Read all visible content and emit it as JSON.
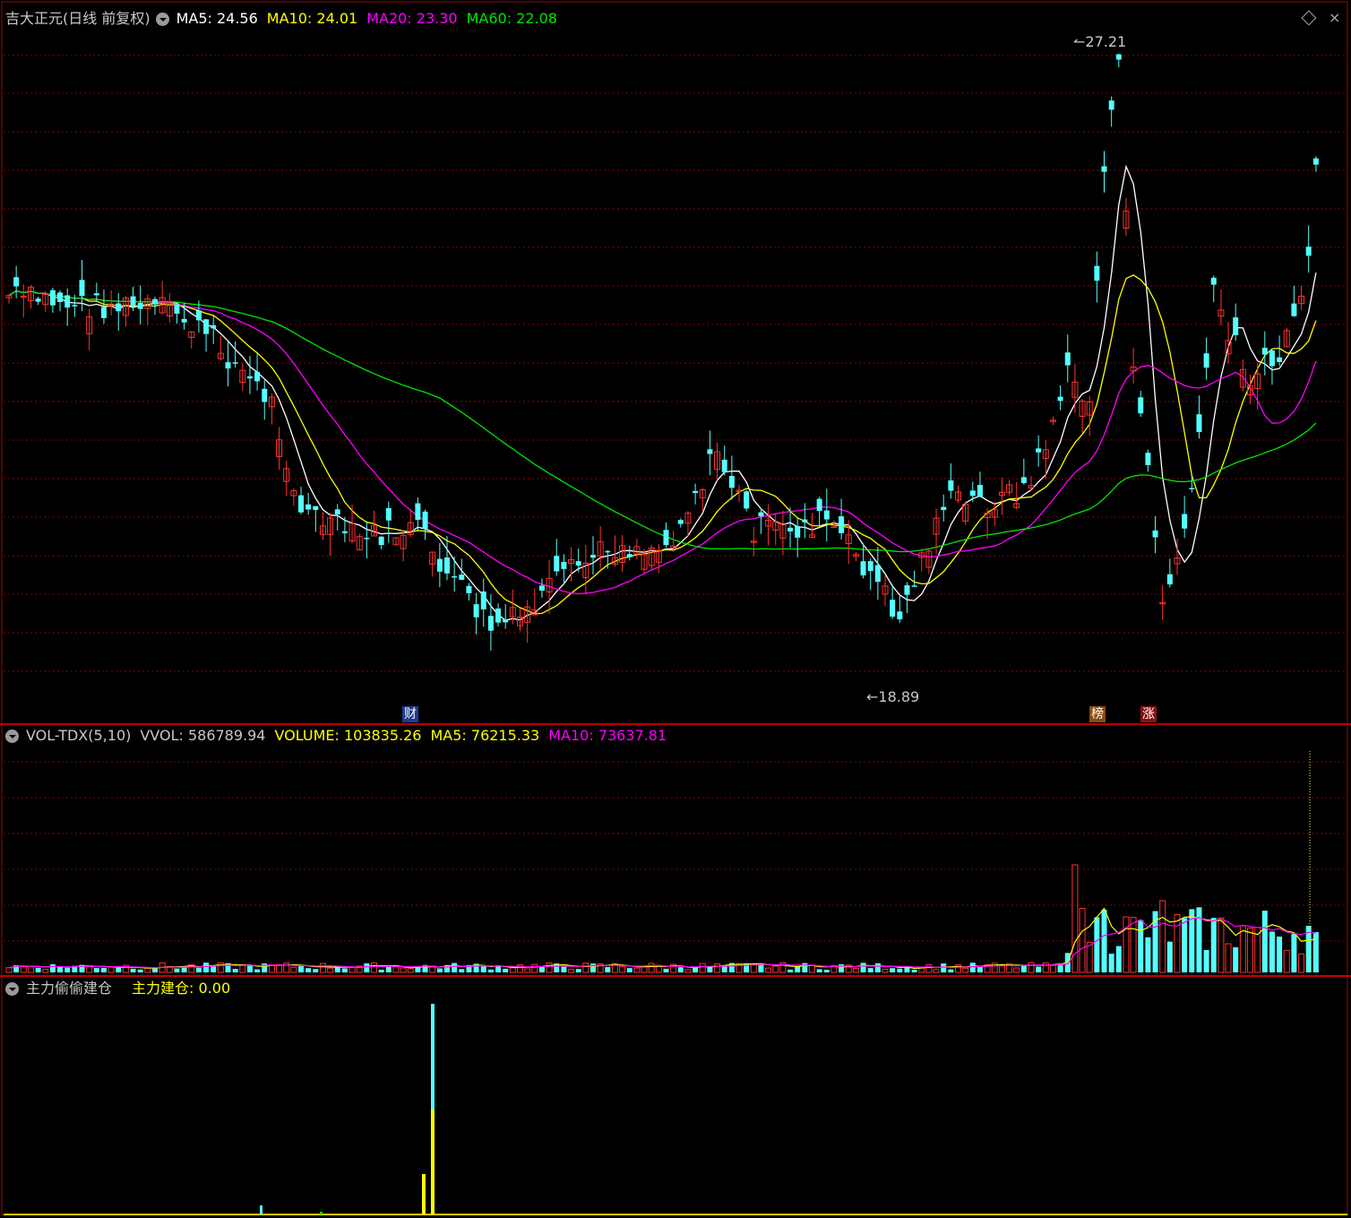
{
  "main_header": {
    "title": "吉大正元(日线 前复权)",
    "ma5": "MA5: 24.56",
    "ma10": "MA10: 24.01",
    "ma20": "MA20: 23.30",
    "ma60": "MA60: 22.08"
  },
  "vol_header": {
    "name": "VOL-TDX(5,10)",
    "vvol": "VVOL: 586789.94",
    "volume": "VOLUME: 103835.26",
    "ma5": "MA5: 76215.33",
    "ma10": "MA10: 73637.81"
  },
  "ind_header": {
    "name": "主力偷偷建仓",
    "value": "主力建仓: 0.00"
  },
  "markers": {
    "high_label": "27.21",
    "low_label": "18.89",
    "badge_cai": "财",
    "badge_bang": "榜",
    "badge_zhang": "涨"
  },
  "colors": {
    "up": "#ff3232",
    "down": "#54ffff",
    "ma5": "#ffffff",
    "ma10": "#ffff00",
    "ma20": "#ff00ff",
    "ma60": "#00e600",
    "grid": "#8b0000"
  },
  "icons": [
    "dropdown-icon",
    "diamond-icon",
    "close-icon"
  ],
  "chart_data": {
    "type": "candlestick",
    "price_high": 27.21,
    "price_low": 18.89,
    "ma_latest": {
      "MA5": 24.56,
      "MA10": 24.01,
      "MA20": 23.3,
      "MA60": 22.08
    },
    "volume_latest": {
      "VVOL": 586789.94,
      "VOLUME": 103835.26,
      "MA5": 76215.33,
      "MA10": 73637.81
    },
    "indicator_latest": {
      "主力建仓": 0.0
    }
  }
}
